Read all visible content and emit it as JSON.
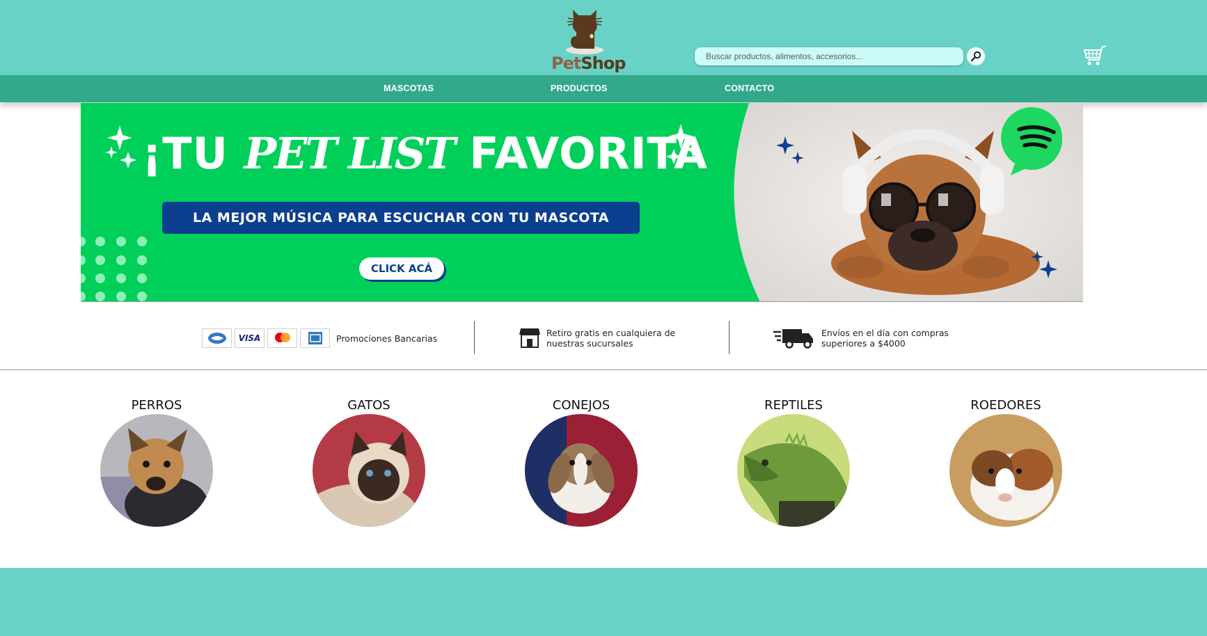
{
  "brand": {
    "name_part1": "Pet",
    "name_part2": "Shop"
  },
  "search": {
    "placeholder": "Buscar productos, alimentos, accesorios..."
  },
  "nav": {
    "items": [
      {
        "label": "MASCOTAS"
      },
      {
        "label": "PRODUCTOS"
      },
      {
        "label": "CONTACTO"
      }
    ]
  },
  "banner": {
    "title_lead": "¡TU",
    "title_script": "PET LIST",
    "title_tail": "FAVORITA",
    "subtitle": "LA MEJOR MÚSICA PARA ESCUCHAR CON TU MASCOTA",
    "cta": "CLICK ACÁ"
  },
  "benefits": {
    "bank": "Promociones Bancarias",
    "pickup_line1": "Retiro gratis en cualquiera de",
    "pickup_line2": "nuestras sucursales",
    "shipping_line1": "Envíos en el día con compras",
    "shipping_line2": "superiores a $4000",
    "cards": [
      "VISA"
    ]
  },
  "categories": [
    {
      "label": "PERROS"
    },
    {
      "label": "GATOS"
    },
    {
      "label": "CONEJOS"
    },
    {
      "label": "REPTILES"
    },
    {
      "label": "ROEDORES"
    }
  ],
  "colors": {
    "header": "#69d2c6",
    "nav": "#33a98c",
    "banner_green": "#00d05a",
    "banner_blue": "#0b3f8f"
  },
  "icons": [
    "cat-logo-icon",
    "search-icon",
    "cart-icon",
    "store-icon",
    "truck-icon",
    "spotify-icon",
    "sparkle-icon"
  ]
}
